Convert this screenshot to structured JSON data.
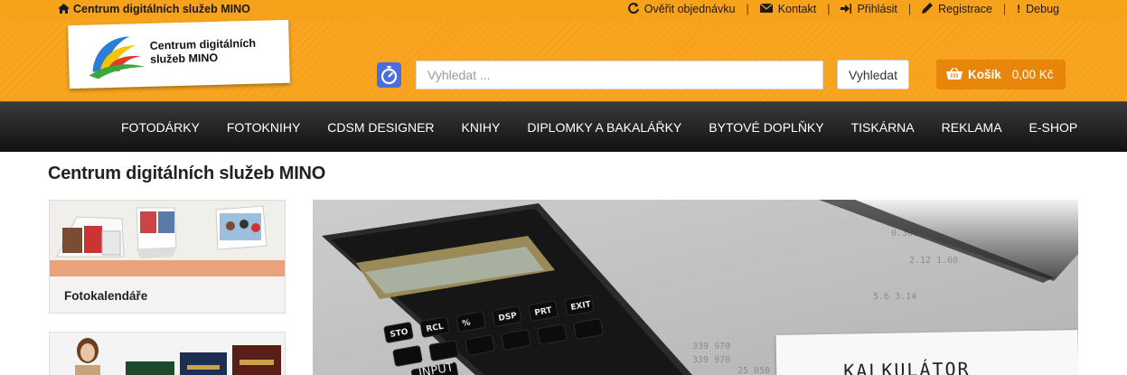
{
  "topbar": {
    "home_label": "Centrum digitálních služeb MINO",
    "links": [
      {
        "icon": "refresh-icon",
        "label": "Ověřit objednávku"
      },
      {
        "icon": "envelope-icon",
        "label": "Kontakt"
      },
      {
        "icon": "sign-in-icon",
        "label": "Přihlásit"
      },
      {
        "icon": "pencil-icon",
        "label": "Registrace"
      },
      {
        "icon": "exclamation-icon",
        "label": "Debug"
      }
    ]
  },
  "header": {
    "logo_line1": "Centrum digitálních",
    "logo_line2": "služeb MINO",
    "search_placeholder": "Vyhledat ...",
    "search_button": "Vyhledat",
    "cart_label": "Košík",
    "cart_total": "0,00 Kč"
  },
  "nav": {
    "items": [
      "FOTODÁRKY",
      "FOTOKNIHY",
      "CDSM DESIGNER",
      "KNIHY",
      "DIPLOMKY A BAKALÁŘKY",
      "BYTOVÉ DOPLŇKY",
      "TISKÁRNA",
      "REKLAMA",
      "E-SHOP"
    ]
  },
  "main": {
    "title": "Centrum digitálních služeb MINO",
    "categories": [
      {
        "label": "Fotokalendáře"
      },
      {
        "label": ""
      }
    ],
    "banner_note": "KALKULÁTOR",
    "calc_keys": [
      "STO",
      "RCL",
      "%",
      "DSP",
      "PRT",
      "EXIT"
    ],
    "calc_input": "INPUT"
  },
  "colors": {
    "brand_orange": "#f7a21b",
    "cart_orange": "#e8850b",
    "nav_dark": "#1c1c1c"
  }
}
